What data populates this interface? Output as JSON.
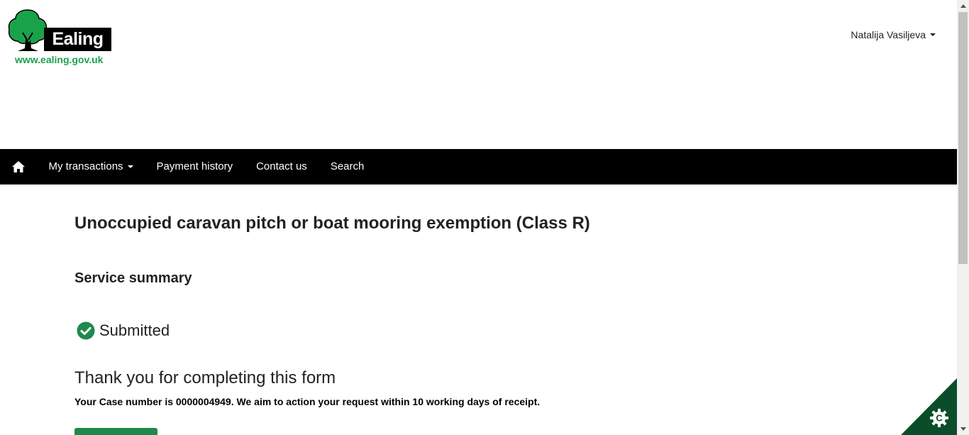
{
  "header": {
    "logo_word": "Ealing",
    "logo_url": "www.ealing.gov.uk",
    "user_name": "Natalija Vasiljeva"
  },
  "nav": {
    "home_icon": "home-icon",
    "items": [
      {
        "label": "My transactions",
        "has_dropdown": true
      },
      {
        "label": "Payment history"
      },
      {
        "label": "Contact us"
      },
      {
        "label": "Search"
      }
    ]
  },
  "main": {
    "title": "Unoccupied caravan pitch or boat mooring exemption (Class R)",
    "section_title": "Service summary",
    "status": {
      "label": "Submitted",
      "icon": "check-circle-icon"
    },
    "thanks": "Thank you for completing this form",
    "case_message": "Your Case number is 0000004949. We aim to action your request within 10 working days of receipt."
  },
  "cookie_settings": {
    "icon": "cookie-icon"
  },
  "colors": {
    "brand_green": "#1aa24b",
    "button_green": "#1d8a4b",
    "nav_bg": "#000000",
    "cookie_corner": "#0b4d2b"
  }
}
